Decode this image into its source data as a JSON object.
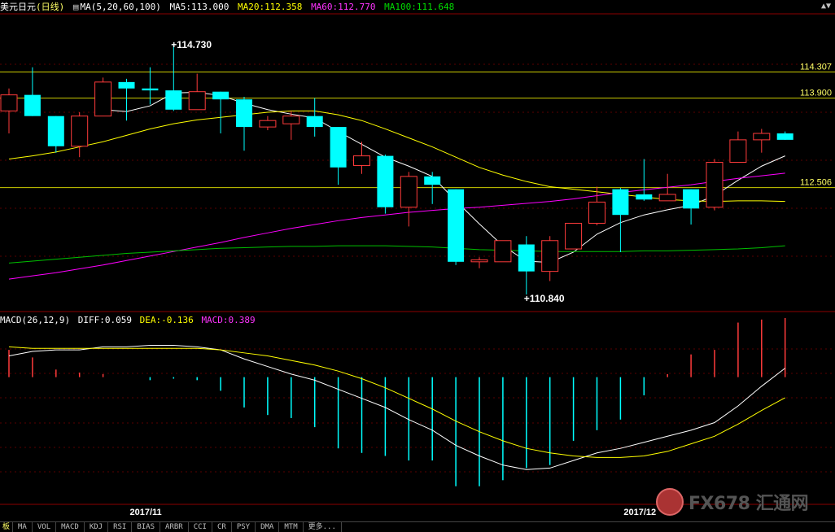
{
  "header": {
    "instrument": "美元日元",
    "period": "(日线)",
    "ma_label": "MA(5,20,60,100)",
    "ma5": "MA5:113.000",
    "ma20": "MA20:112.358",
    "ma60": "MA60:112.770",
    "ma100": "MA100:111.648"
  },
  "macd_header": {
    "label": "MACD(26,12,9)",
    "diff": "DIFF:0.059",
    "dea": "DEA:-0.136",
    "macd": "MACD:0.389"
  },
  "colors": {
    "up": "#ff3b3b",
    "down": "#00ffff",
    "ma5": "#ffffff",
    "ma20": "#ffff00",
    "ma60": "#ff00ff",
    "ma100": "#00c000",
    "ref_line": "#cccc00",
    "axis": "#8b0000"
  },
  "tabs": [
    "板",
    "MA",
    "VOL",
    "MACD",
    "KDJ",
    "RSI",
    "BIAS",
    "ARBR",
    "CCI",
    "CR",
    "PSY",
    "DMA",
    "MTM",
    "更多..."
  ],
  "watermark": "FX678 汇通网",
  "chart_data": [
    {
      "type": "candlestick",
      "title": "美元日元(日线)",
      "ylim": [
        110.6,
        115.2
      ],
      "reference_lines": [
        114.307,
        113.9,
        112.506
      ],
      "annotations": [
        {
          "label": "114.730",
          "value": 114.73,
          "index": 7
        },
        {
          "label": "110.840",
          "value": 110.84,
          "index": 22
        }
      ],
      "x_labels": [
        {
          "label": "2017/11",
          "index": 5
        },
        {
          "label": "2017/12",
          "index": 26
        }
      ],
      "candles": [
        {
          "o": 113.7,
          "c": 113.95,
          "h": 114.05,
          "l": 113.35
        },
        {
          "o": 113.95,
          "c": 113.62,
          "h": 114.38,
          "l": 113.62
        },
        {
          "o": 113.62,
          "c": 113.15,
          "h": 113.62,
          "l": 113.05
        },
        {
          "o": 113.15,
          "c": 113.62,
          "h": 113.68,
          "l": 112.98
        },
        {
          "o": 113.62,
          "c": 114.15,
          "h": 114.22,
          "l": 113.62
        },
        {
          "o": 114.15,
          "c": 114.05,
          "h": 114.2,
          "l": 113.55
        },
        {
          "o": 114.05,
          "c": 114.02,
          "h": 114.38,
          "l": 113.8
        },
        {
          "o": 114.02,
          "c": 113.72,
          "h": 114.73,
          "l": 113.7
        },
        {
          "o": 113.72,
          "c": 114.0,
          "h": 114.28,
          "l": 113.72
        },
        {
          "o": 114.0,
          "c": 113.88,
          "h": 114.0,
          "l": 113.35
        },
        {
          "o": 113.88,
          "c": 113.45,
          "h": 113.92,
          "l": 113.08
        },
        {
          "o": 113.45,
          "c": 113.55,
          "h": 113.62,
          "l": 113.4
        },
        {
          "o": 113.5,
          "c": 113.62,
          "h": 113.7,
          "l": 113.25
        },
        {
          "o": 113.62,
          "c": 113.45,
          "h": 113.9,
          "l": 113.3
        },
        {
          "o": 113.45,
          "c": 112.82,
          "h": 113.45,
          "l": 112.55
        },
        {
          "o": 112.85,
          "c": 113.0,
          "h": 113.22,
          "l": 112.72
        },
        {
          "o": 113.0,
          "c": 112.2,
          "h": 113.02,
          "l": 112.1
        },
        {
          "o": 112.2,
          "c": 112.68,
          "h": 112.75,
          "l": 111.9
        },
        {
          "o": 112.68,
          "c": 112.55,
          "h": 112.75,
          "l": 112.25
        },
        {
          "o": 112.48,
          "c": 111.35,
          "h": 112.48,
          "l": 111.3
        },
        {
          "o": 111.35,
          "c": 111.38,
          "h": 111.42,
          "l": 111.25
        },
        {
          "o": 111.35,
          "c": 111.68,
          "h": 111.68,
          "l": 111.35
        },
        {
          "o": 111.62,
          "c": 111.2,
          "h": 111.75,
          "l": 110.84
        },
        {
          "o": 111.2,
          "c": 111.68,
          "h": 111.75,
          "l": 111.05
        },
        {
          "o": 111.55,
          "c": 111.95,
          "h": 111.95,
          "l": 111.55
        },
        {
          "o": 111.95,
          "c": 112.28,
          "h": 112.52,
          "l": 111.92
        },
        {
          "o": 112.48,
          "c": 112.08,
          "h": 112.5,
          "l": 111.5
        },
        {
          "o": 112.4,
          "c": 112.32,
          "h": 112.95,
          "l": 112.3
        },
        {
          "o": 112.3,
          "c": 112.4,
          "h": 112.72,
          "l": 112.3
        },
        {
          "o": 112.48,
          "c": 112.18,
          "h": 112.48,
          "l": 111.93
        },
        {
          "o": 112.2,
          "c": 112.9,
          "h": 112.95,
          "l": 112.15
        },
        {
          "o": 112.9,
          "c": 113.25,
          "h": 113.38,
          "l": 112.9
        },
        {
          "o": 113.25,
          "c": 113.35,
          "h": 113.42,
          "l": 113.05
        },
        {
          "o": 113.35,
          "c": 113.25,
          "h": 113.38,
          "l": 113.25
        }
      ],
      "series": [
        {
          "name": "MA5",
          "values": [
            null,
            null,
            null,
            null,
            113.72,
            113.69,
            113.78,
            113.98,
            113.99,
            113.94,
            113.82,
            113.72,
            113.65,
            113.59,
            113.38,
            113.18,
            112.98,
            112.84,
            112.68,
            112.3,
            111.94,
            111.6,
            111.36,
            111.34,
            111.5,
            111.78,
            111.96,
            112.08,
            112.16,
            112.23,
            112.38,
            112.62,
            112.84,
            113.0
          ]
        },
        {
          "name": "MA20",
          "values": [
            112.95,
            113.0,
            113.06,
            113.14,
            113.22,
            113.32,
            113.42,
            113.5,
            113.56,
            113.6,
            113.64,
            113.68,
            113.7,
            113.7,
            113.64,
            113.55,
            113.42,
            113.28,
            113.14,
            112.98,
            112.82,
            112.7,
            112.6,
            112.52,
            112.48,
            112.44,
            112.4,
            112.36,
            112.32,
            112.3,
            112.29,
            112.3,
            112.3,
            112.29
          ]
        },
        {
          "name": "MA60",
          "values": [
            111.08,
            111.13,
            111.18,
            111.24,
            111.3,
            111.37,
            111.44,
            111.51,
            111.58,
            111.65,
            111.73,
            111.8,
            111.87,
            111.93,
            111.99,
            112.04,
            112.08,
            112.12,
            112.15,
            112.18,
            112.2,
            112.23,
            112.26,
            112.29,
            112.33,
            112.38,
            112.43,
            112.47,
            112.51,
            112.55,
            112.6,
            112.65,
            112.69,
            112.73
          ]
        },
        {
          "name": "MA100",
          "values": [
            111.33,
            111.36,
            111.39,
            111.42,
            111.45,
            111.48,
            111.5,
            111.52,
            111.54,
            111.56,
            111.57,
            111.58,
            111.59,
            111.59,
            111.6,
            111.6,
            111.6,
            111.59,
            111.58,
            111.56,
            111.54,
            111.53,
            111.52,
            111.51,
            111.51,
            111.51,
            111.51,
            111.52,
            111.52,
            111.53,
            111.54,
            111.55,
            111.57,
            111.6
          ]
        }
      ]
    },
    {
      "type": "bar",
      "title": "MACD(26,12,9)",
      "ylim": [
        -0.85,
        0.32
      ],
      "series": [
        {
          "name": "MACD",
          "values": [
            0.18,
            0.13,
            0.05,
            0.03,
            0.02,
            0.0,
            -0.02,
            -0.01,
            -0.02,
            -0.09,
            -0.2,
            -0.25,
            -0.27,
            -0.33,
            -0.47,
            -0.5,
            -0.52,
            -0.55,
            -0.55,
            -0.72,
            -0.72,
            -0.68,
            -0.6,
            -0.58,
            -0.42,
            -0.35,
            -0.28,
            -0.12,
            0.02,
            0.15,
            0.18,
            0.36,
            0.38,
            0.39
          ]
        },
        {
          "name": "DIFF",
          "values": [
            0.14,
            0.17,
            0.18,
            0.18,
            0.2,
            0.2,
            0.21,
            0.21,
            0.2,
            0.18,
            0.12,
            0.07,
            0.02,
            -0.02,
            -0.08,
            -0.14,
            -0.2,
            -0.28,
            -0.35,
            -0.45,
            -0.52,
            -0.58,
            -0.61,
            -0.6,
            -0.55,
            -0.5,
            -0.47,
            -0.43,
            -0.39,
            -0.35,
            -0.3,
            -0.19,
            -0.06,
            0.059
          ]
        },
        {
          "name": "DEA",
          "values": [
            0.2,
            0.19,
            0.19,
            0.19,
            0.19,
            0.19,
            0.19,
            0.19,
            0.19,
            0.18,
            0.16,
            0.14,
            0.11,
            0.08,
            0.04,
            -0.01,
            -0.07,
            -0.14,
            -0.21,
            -0.29,
            -0.36,
            -0.42,
            -0.47,
            -0.5,
            -0.52,
            -0.53,
            -0.53,
            -0.52,
            -0.49,
            -0.44,
            -0.39,
            -0.31,
            -0.22,
            -0.136
          ]
        }
      ]
    }
  ]
}
